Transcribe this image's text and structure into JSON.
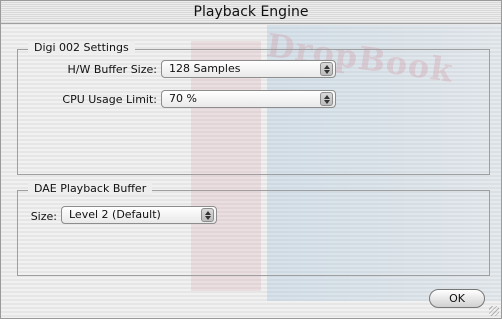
{
  "window": {
    "title": "Playback Engine"
  },
  "digi_group": {
    "label": "Digi 002 Settings",
    "hw_buffer_label": "H/W Buffer Size:",
    "hw_buffer_value": "128 Samples",
    "cpu_limit_label": "CPU Usage Limit:",
    "cpu_limit_value": "70 %"
  },
  "dae_group": {
    "label": "DAE Playback Buffer",
    "size_label": "Size:",
    "size_value": "Level 2 (Default)"
  },
  "actions": {
    "ok_label": "OK"
  },
  "watermark": {
    "text": "DropBook"
  }
}
